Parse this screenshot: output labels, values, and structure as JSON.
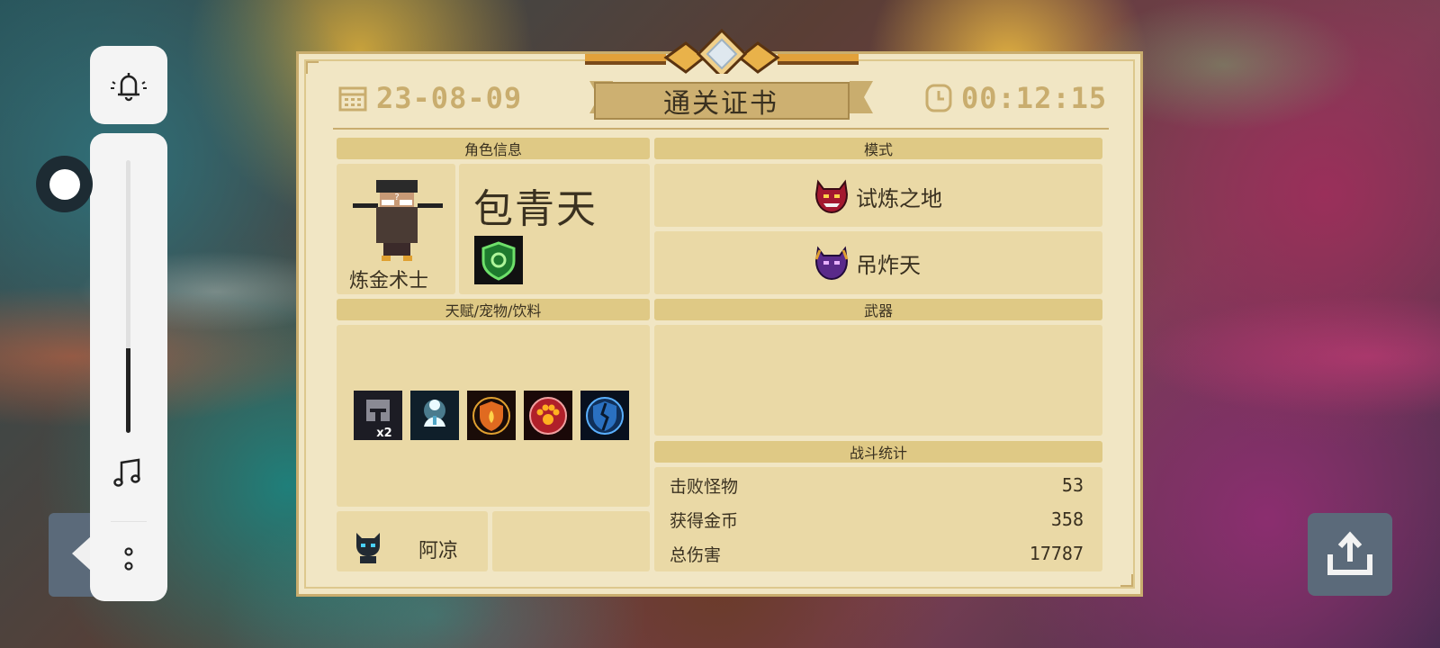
{
  "certificate": {
    "title": "通关证书",
    "date": "23-08-09",
    "time": "00:12:15"
  },
  "sections": {
    "character_info": "角色信息",
    "mode": "模式",
    "talents": "天赋/宠物/饮料",
    "weapons": "武器",
    "battle_stats": "战斗统计"
  },
  "character": {
    "name": "包青天",
    "class": "炼金术士",
    "skill_icon": "green-shield-icon"
  },
  "modes": [
    {
      "label": "试炼之地",
      "icon": "red-demon-icon"
    },
    {
      "label": "吊炸天",
      "icon": "purple-demon-icon"
    }
  ],
  "buffs": [
    {
      "icon": "knight-helmet-x2-icon",
      "badge": "x2"
    },
    {
      "icon": "ghost-meditation-icon"
    },
    {
      "icon": "fire-shield-icon"
    },
    {
      "icon": "paw-icon"
    },
    {
      "icon": "broken-shield-icon"
    }
  ],
  "pet": {
    "name": "阿凉",
    "icon": "black-cat-icon"
  },
  "stats": [
    {
      "label": "击败怪物",
      "value": "53"
    },
    {
      "label": "获得金币",
      "value": "358"
    },
    {
      "label": "总伤害",
      "value": "17787"
    }
  ],
  "controls": {
    "volume_level": 0.31,
    "icons": [
      "bell-icon",
      "music-note-icon",
      "more-dots-icon",
      "back-arrow-icon",
      "share-icon"
    ]
  },
  "colors": {
    "parchment": "#f1e6c4",
    "header": "#dfc985",
    "gold": "#c9ad6e",
    "text": "#3a3120"
  }
}
